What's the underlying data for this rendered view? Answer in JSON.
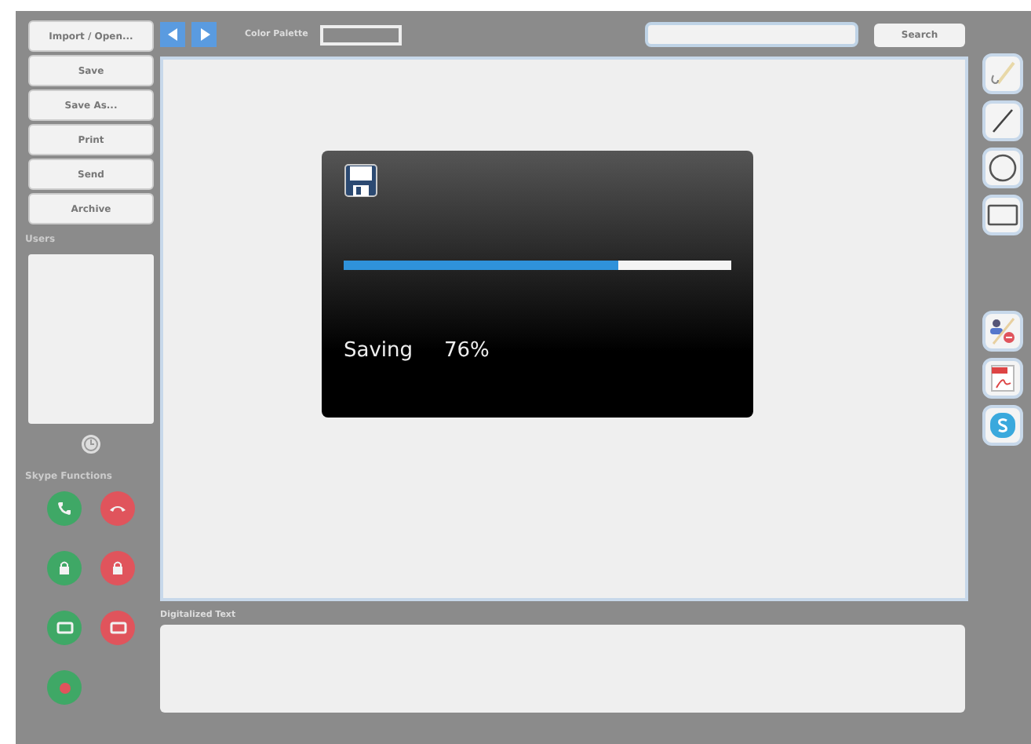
{
  "sidebar": {
    "buttons": [
      "Import / Open...",
      "Save",
      "Save As...",
      "Print",
      "Send",
      "Archive"
    ],
    "users_label": "Users",
    "skype_label": "Skype Functions",
    "skype_buttons": [
      {
        "kind": "phone",
        "color": "#3fa866"
      },
      {
        "kind": "hangup",
        "color": "#e0545c"
      },
      {
        "kind": "lock",
        "color": "#3fa866"
      },
      {
        "kind": "lock",
        "color": "#e0545c"
      },
      {
        "kind": "video",
        "color": "#3fa866"
      },
      {
        "kind": "video",
        "color": "#e0545c"
      },
      {
        "kind": "record",
        "color": "#3fa866"
      }
    ]
  },
  "toolbar": {
    "palette_label": "Color Palette",
    "search_button": "Search"
  },
  "dialog": {
    "status": "Saving",
    "percent": "76%",
    "level": 0.71
  },
  "tools": [
    {
      "kind": "pen"
    },
    {
      "kind": "line"
    },
    {
      "kind": "circle"
    },
    {
      "kind": "rect"
    },
    {
      "kind": "gap"
    },
    {
      "kind": "user-block"
    },
    {
      "kind": "pdf"
    },
    {
      "kind": "skype"
    }
  ],
  "digitized": {
    "label": "Digitalized Text"
  }
}
